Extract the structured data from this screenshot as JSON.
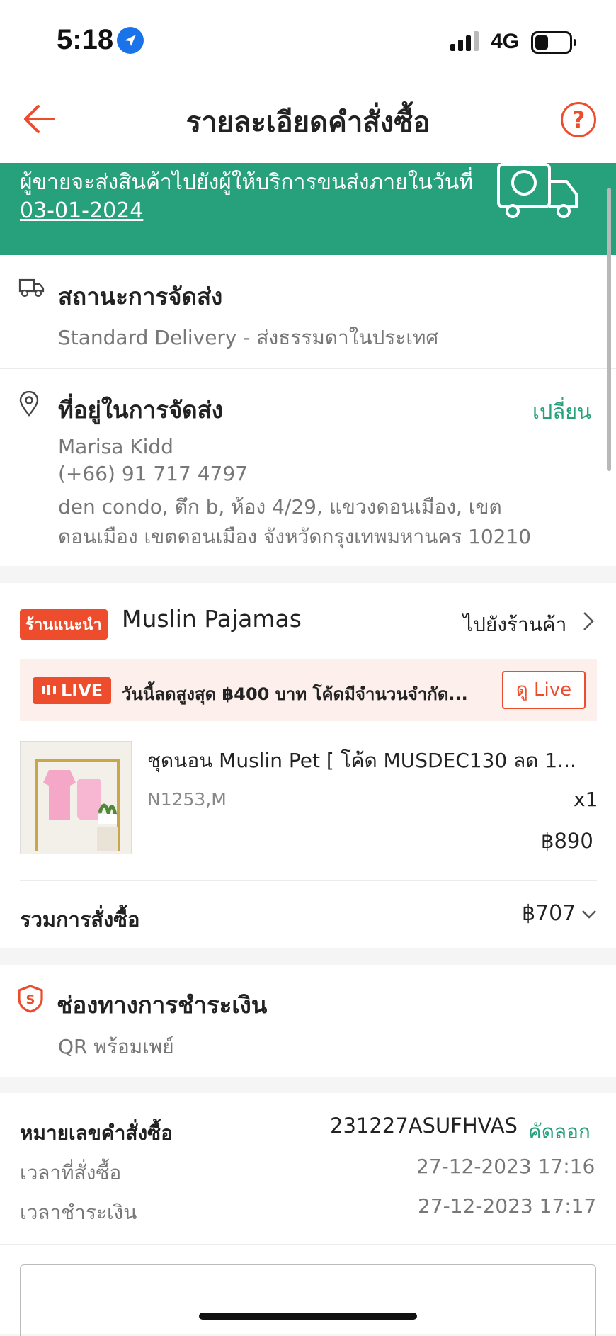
{
  "status_bar": {
    "time": "5:18",
    "network": "4G"
  },
  "header": {
    "title": "รายละเอียดคำสั่งซื้อ",
    "help_label": "?"
  },
  "banner": {
    "text": "ผู้ขายจะส่งสินค้าไปยังผู้ให้บริการขนส่งภายในวันที่",
    "date": "03-01-2024"
  },
  "shipping": {
    "title": "สถานะการจัดส่ง",
    "method": "Standard Delivery - ส่งธรรมดาในประเทศ"
  },
  "address": {
    "title": "ที่อยู่ในการจัดส่ง",
    "change_label": "เปลี่ยน",
    "name": "Marisa Kidd",
    "phone": "(+66) 91 717 4797",
    "line1": "den condo, ตึก b, ห้อง 4/29, แขวงดอนเมือง, เขต",
    "line2": "ดอนเมือง เขตดอนเมือง จังหวัดกรุงเทพมหานคร 10210"
  },
  "shop": {
    "badge": "ร้านแนะนำ",
    "name": "Muslin Pajamas",
    "goto_label": "ไปยังร้านค้า",
    "live": {
      "badge": "LIVE",
      "text": "วันนี้ลดสูงสุด ฿400 บาท โค้ดมีจำนวนจำกัด...",
      "button": "ดู Live"
    },
    "product": {
      "name": "ชุดนอน Muslin Pet [ โค้ด MUSDEC130 ลด 1...",
      "variant": "N1253,M",
      "qty": "x1",
      "price": "฿890"
    },
    "total_label": "รวมการสั่งซื้อ",
    "total_value": "฿707"
  },
  "payment": {
    "title": "ช่องทางการชำระเงิน",
    "method": "QR พร้อมเพย์"
  },
  "order": {
    "number_label": "หมายเลขคำสั่งซื้อ",
    "number_value": "231227ASUFHVAS",
    "copy_label": "คัดลอก",
    "order_time_label": "เวลาที่สั่งซื้อ",
    "order_time_value": "27-12-2023 17:16",
    "pay_time_label": "เวลาชำระเงิน",
    "pay_time_value": "27-12-2023 17:17"
  },
  "colors": {
    "accent": "#ee4d2d",
    "teal": "#26a17c",
    "banner": "#26a17c"
  }
}
